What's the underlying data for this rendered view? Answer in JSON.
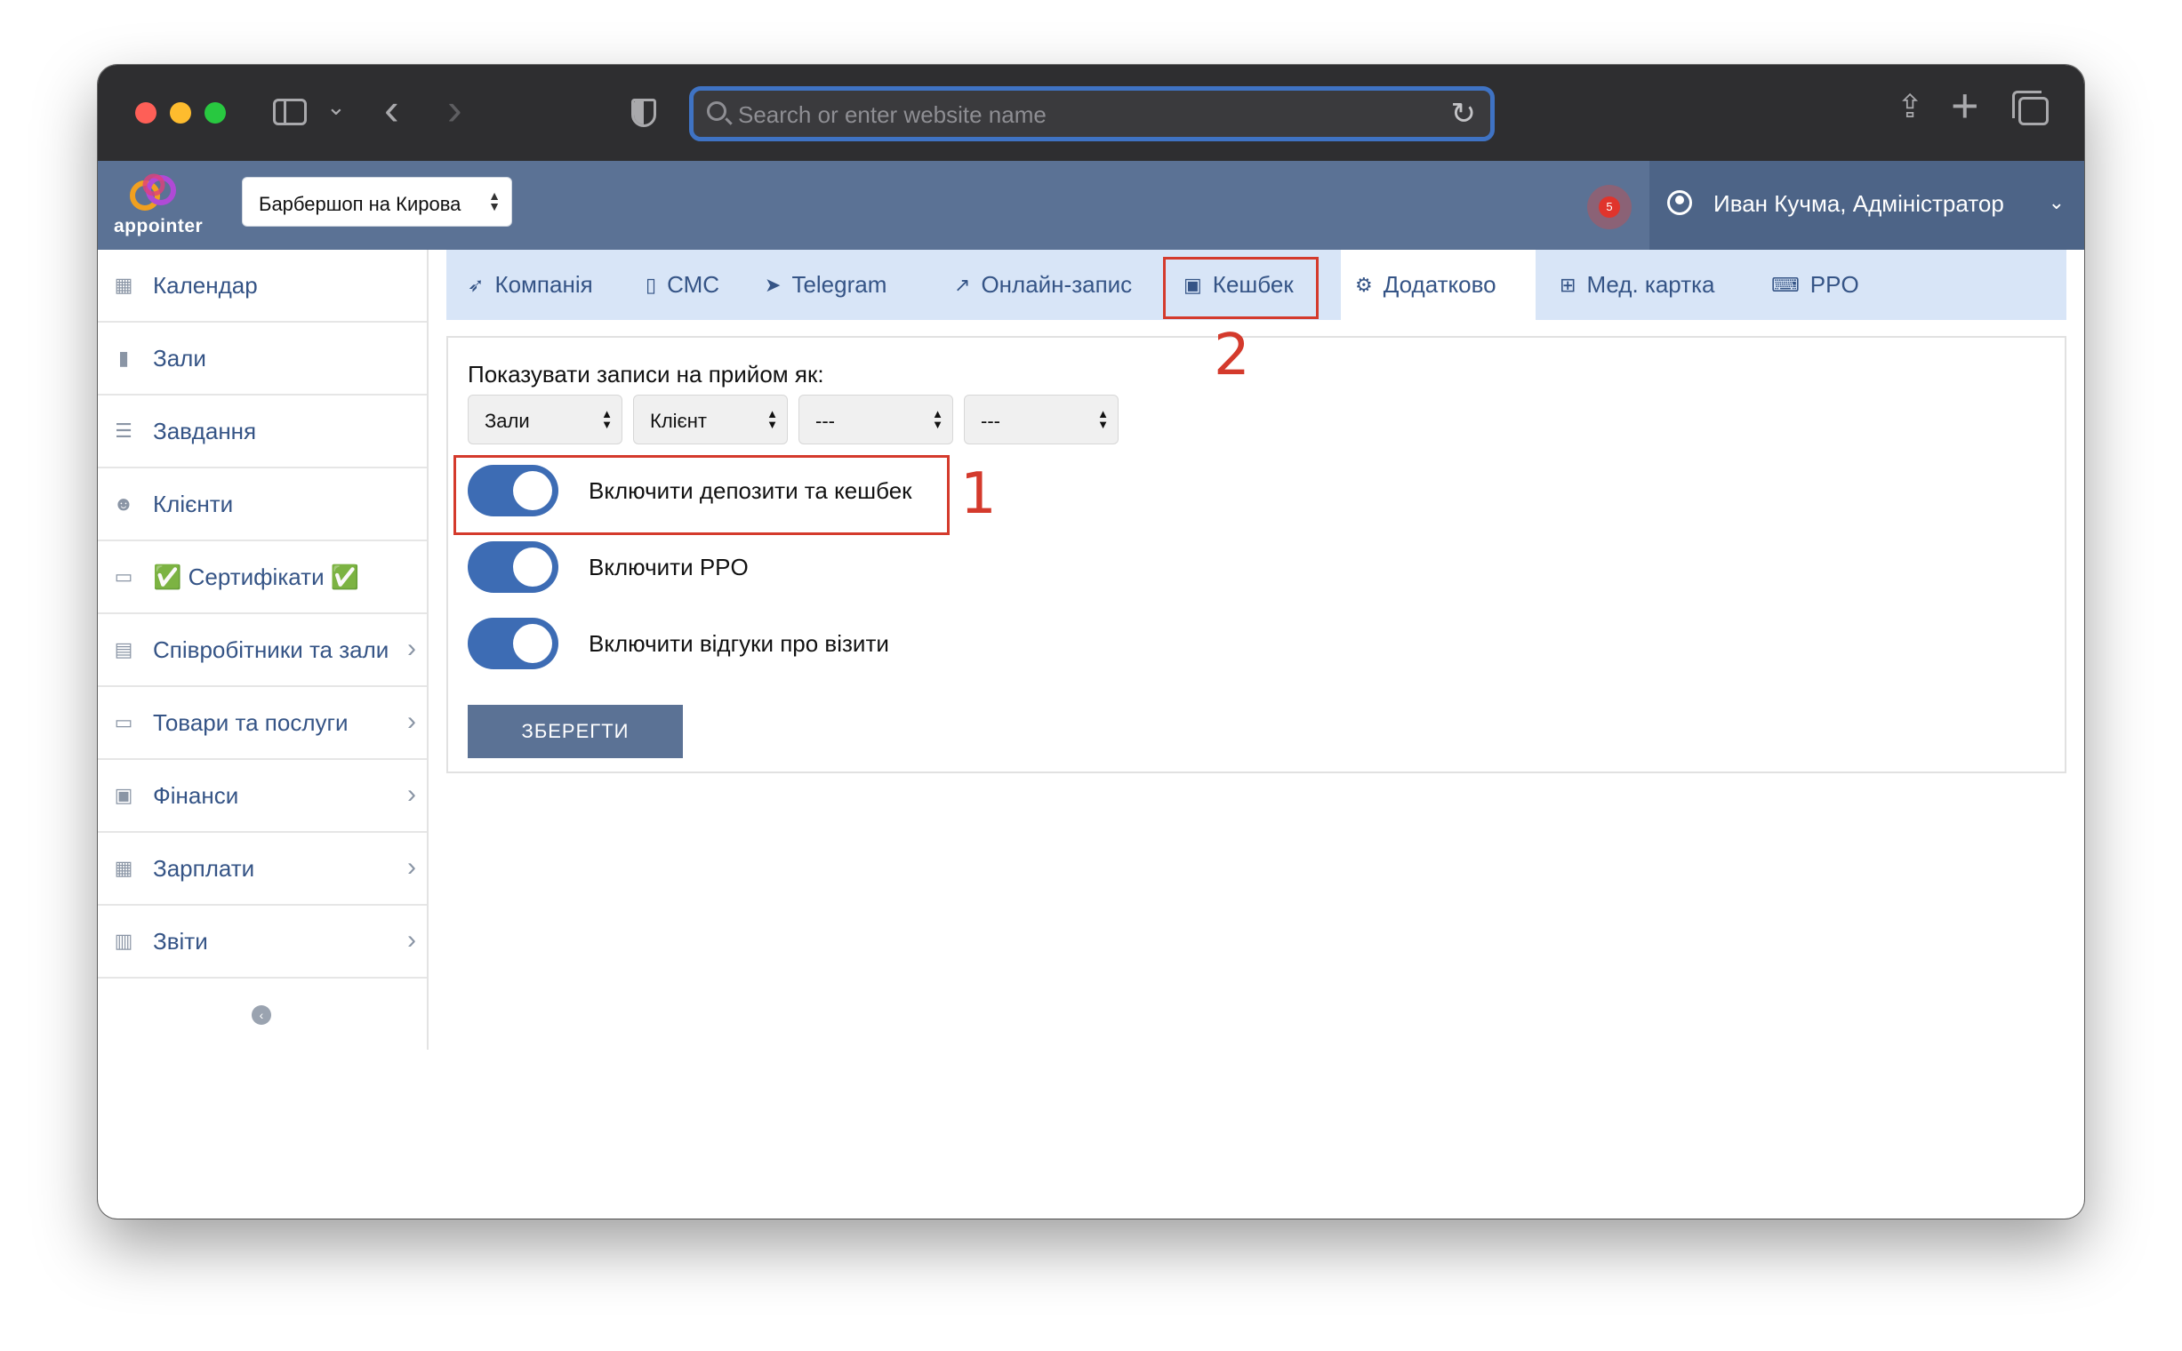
{
  "browser": {
    "url_placeholder": "Search or enter website name"
  },
  "app": {
    "logo_text": "appointer",
    "branch": "Барбершоп на Кирова",
    "notification_count": "5",
    "user": "Иван Кучма, Адміністратор"
  },
  "sidebar": {
    "items": [
      {
        "label": "Календар",
        "icon": "calendar-icon",
        "arrow": false
      },
      {
        "label": "Зали",
        "icon": "bookmark-icon",
        "arrow": false
      },
      {
        "label": "Завдання",
        "icon": "tasks-icon",
        "arrow": false
      },
      {
        "label": "Клієнти",
        "icon": "users-icon",
        "arrow": false
      },
      {
        "label": "✅ Сертифікати ✅",
        "icon": "card-icon",
        "arrow": false
      },
      {
        "label": "Співробітники та зали",
        "icon": "id-card-icon",
        "arrow": true
      },
      {
        "label": "Товари та послуги",
        "icon": "card-icon",
        "arrow": true
      },
      {
        "label": "Фінанси",
        "icon": "money-icon",
        "arrow": true
      },
      {
        "label": "Зарплати",
        "icon": "calculator-icon",
        "arrow": true
      },
      {
        "label": "Звіти",
        "icon": "bar-chart-icon",
        "arrow": true
      }
    ]
  },
  "tabs": [
    {
      "label": "Компанія",
      "icon": "rocket-icon"
    },
    {
      "label": "СМС",
      "icon": "mobile-icon"
    },
    {
      "label": "Telegram",
      "icon": "telegram-icon"
    },
    {
      "label": "Онлайн-запис",
      "icon": "external-link-icon"
    },
    {
      "label": "Кешбек",
      "icon": "money-icon"
    },
    {
      "label": "Додатково",
      "icon": "cogs-icon"
    },
    {
      "label": "Мед. картка",
      "icon": "plus-square-icon"
    },
    {
      "label": "PPO",
      "icon": "keyboard-icon"
    }
  ],
  "panel": {
    "show_label": "Показувати записи на прийом як:",
    "selects": [
      "Зали",
      "Клієнт",
      "---",
      "---"
    ],
    "toggles": [
      {
        "label": "Включити депозити та кешбек",
        "on": true
      },
      {
        "label": "Включити PPO",
        "on": true
      },
      {
        "label": "Включити відгуки про візити",
        "on": true
      }
    ],
    "save_label": "ЗБЕРЕГТИ"
  },
  "annotations": [
    "1",
    "2"
  ],
  "colors": {
    "header": "#5b7295",
    "tab_bar": "#d8e5f7",
    "toggle_on": "#3d6cb4",
    "annotation": "#d43a2c",
    "link": "#355486"
  }
}
